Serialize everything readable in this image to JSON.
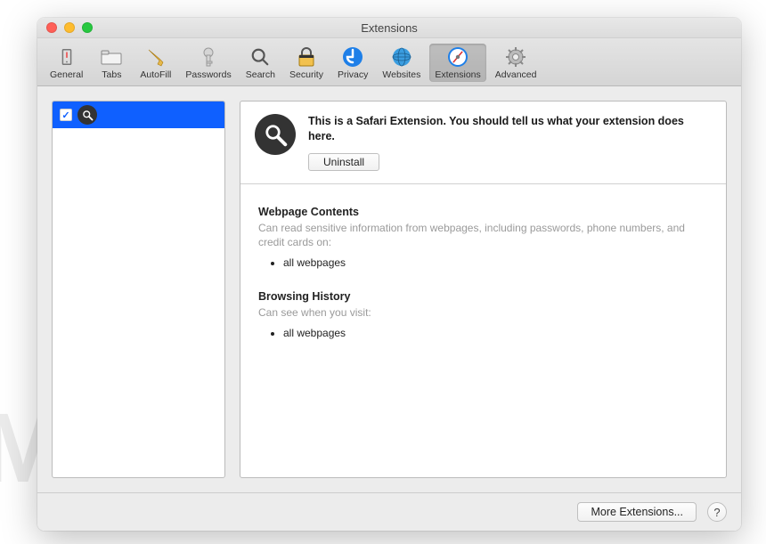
{
  "window": {
    "title": "Extensions"
  },
  "toolbar": {
    "items": [
      {
        "label": "General"
      },
      {
        "label": "Tabs"
      },
      {
        "label": "AutoFill"
      },
      {
        "label": "Passwords"
      },
      {
        "label": "Search"
      },
      {
        "label": "Security"
      },
      {
        "label": "Privacy"
      },
      {
        "label": "Websites"
      },
      {
        "label": "Extensions"
      },
      {
        "label": "Advanced"
      }
    ]
  },
  "sidebar": {
    "items": [
      {
        "checked": true,
        "icon": "search"
      }
    ]
  },
  "details": {
    "description": "This is a Safari Extension. You should tell us what your extension does here.",
    "uninstall_label": "Uninstall",
    "permissions": [
      {
        "title": "Webpage Contents",
        "sub": "Can read sensitive information from webpages, including passwords, phone numbers, and credit cards on:",
        "items": [
          "all webpages"
        ]
      },
      {
        "title": "Browsing History",
        "sub": "Can see when you visit:",
        "items": [
          "all webpages"
        ]
      }
    ]
  },
  "footer": {
    "more_label": "More Extensions...",
    "help_label": "?"
  },
  "watermark": "MALWARETIPS"
}
